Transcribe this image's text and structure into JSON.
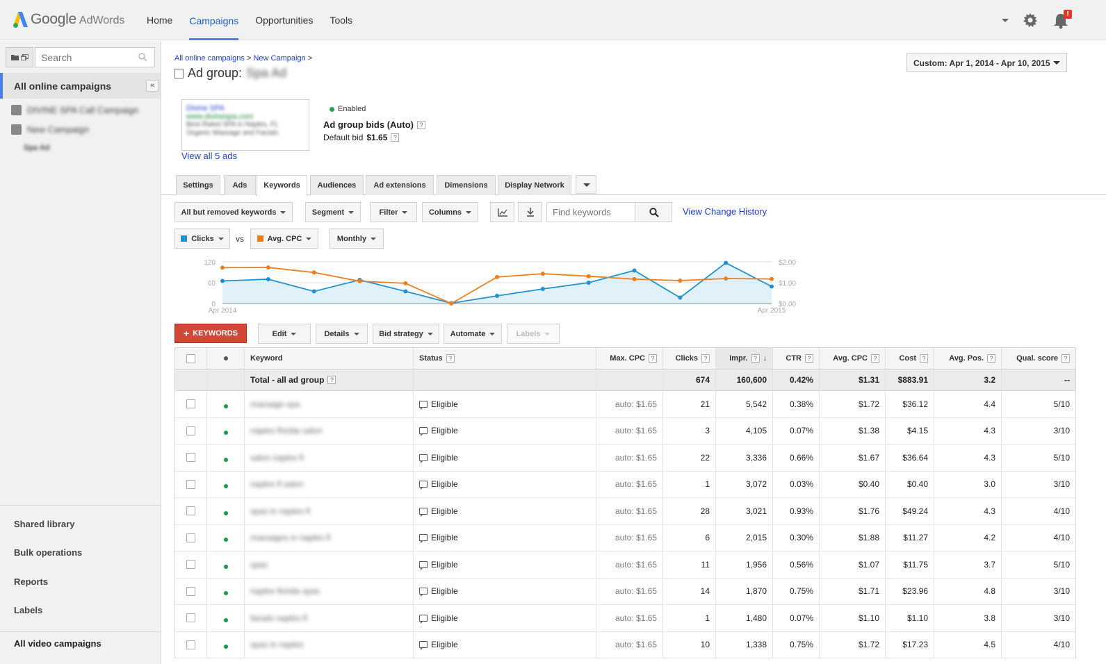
{
  "app": {
    "logo_google": "Google",
    "logo_adwords": "AdWords",
    "nav": [
      "Home",
      "Campaigns",
      "Opportunities",
      "Tools"
    ],
    "nav_active": "Campaigns",
    "notification_badge": "!"
  },
  "sidebar": {
    "search_placeholder": "Search",
    "all_campaigns": "All online campaigns",
    "collapse_glyph": "«",
    "campaigns": [
      {
        "name": "DIVINE SPA Call Campaign",
        "icon": "search-campaign-icon"
      },
      {
        "name": "New Campaign",
        "icon": "display-campaign-icon"
      }
    ],
    "ad_group": "Spa Ad",
    "bottom": [
      "Shared library",
      "Bulk operations",
      "Reports",
      "Labels"
    ],
    "video": "All video campaigns"
  },
  "header": {
    "breadcrumb": [
      "All online campaigns",
      "New Campaign"
    ],
    "separator": ">",
    "title_prefix": "Ad group:",
    "title_name": "Spa Ad",
    "date_range": "Custom: Apr 1, 2014 - Apr 10, 2015"
  },
  "ad_summary": {
    "preview_lines": [
      "Divine SPA",
      "www.divinespa.com",
      "Best Rated SPA in Naples, FL",
      "Organic Massage and Facials"
    ],
    "view_all": "View all 5 ads",
    "status": "Enabled",
    "bids_label": "Ad group bids (Auto)",
    "default_bid_label": "Default bid",
    "default_bid_value": "$1.65"
  },
  "tabs": [
    "Settings",
    "Ads",
    "Keywords",
    "Audiences",
    "Ad extensions",
    "Dimensions",
    "Display Network"
  ],
  "tab_active": "Keywords",
  "toolbar": {
    "filter_view": "All but removed keywords",
    "segment": "Segment",
    "filter": "Filter",
    "columns": "Columns",
    "find_placeholder": "Find keywords",
    "view_change_history": "View Change History"
  },
  "chart_controls": {
    "metric1": "Clicks",
    "vs": "vs",
    "metric2": "Avg. CPC",
    "period": "Monthly"
  },
  "chart_data": {
    "type": "line",
    "x": [
      "Apr 2014",
      "May 2014",
      "Jun 2014",
      "Jul 2014",
      "Aug 2014",
      "Sep 2014",
      "Oct 2014",
      "Nov 2014",
      "Dec 2014",
      "Jan 2015",
      "Feb 2015",
      "Mar 2015",
      "Apr 2015"
    ],
    "x_tick_labels": [
      "Apr 2014",
      "Apr 2015"
    ],
    "series": [
      {
        "name": "Clicks",
        "axis": "left",
        "color": "#1f91d2",
        "values": [
          65,
          70,
          35,
          68,
          35,
          1,
          22,
          42,
          60,
          95,
          17,
          117,
          49
        ]
      },
      {
        "name": "Avg. CPC",
        "axis": "right",
        "color": "#f07d1b",
        "values": [
          1.72,
          1.73,
          1.49,
          1.07,
          0.97,
          0.0,
          1.27,
          1.43,
          1.31,
          1.17,
          1.1,
          1.2,
          1.18
        ]
      }
    ],
    "y_left": {
      "ticks": [
        "120",
        "60",
        "0"
      ],
      "range": [
        0,
        120
      ]
    },
    "y_right": {
      "ticks": [
        "$2.00",
        "$1.00",
        "$0.00"
      ],
      "range": [
        0,
        2
      ]
    },
    "grid": true
  },
  "actions": {
    "add_keywords": "KEYWORDS",
    "edit": "Edit",
    "details": "Details",
    "bid_strategy": "Bid strategy",
    "automate": "Automate",
    "labels": "Labels"
  },
  "table": {
    "headers": {
      "keyword": "Keyword",
      "status": "Status",
      "max_cpc": "Max. CPC",
      "clicks": "Clicks",
      "impr": "Impr.",
      "ctr": "CTR",
      "avg_cpc": "Avg. CPC",
      "cost": "Cost",
      "avg_pos": "Avg. Pos.",
      "qual": "Qual. score"
    },
    "total": {
      "label": "Total - all ad group",
      "clicks": "674",
      "impr": "160,600",
      "ctr": "0.42%",
      "avg_cpc": "$1.31",
      "cost": "$883.91",
      "avg_pos": "3.2",
      "qual": "--"
    },
    "rows": [
      {
        "keyword": "massage spa",
        "status": "Eligible",
        "max_cpc": "auto: $1.65",
        "clicks": "21",
        "impr": "5,542",
        "ctr": "0.38%",
        "avg_cpc": "$1.72",
        "cost": "$36.12",
        "avg_pos": "4.4",
        "qual": "5/10"
      },
      {
        "keyword": "naples florida salon",
        "status": "Eligible",
        "max_cpc": "auto: $1.65",
        "clicks": "3",
        "impr": "4,105",
        "ctr": "0.07%",
        "avg_cpc": "$1.38",
        "cost": "$4.15",
        "avg_pos": "4.3",
        "qual": "3/10"
      },
      {
        "keyword": "salon naples fl",
        "status": "Eligible",
        "max_cpc": "auto: $1.65",
        "clicks": "22",
        "impr": "3,336",
        "ctr": "0.66%",
        "avg_cpc": "$1.67",
        "cost": "$36.64",
        "avg_pos": "4.3",
        "qual": "5/10"
      },
      {
        "keyword": "naples fl salon",
        "status": "Eligible",
        "max_cpc": "auto: $1.65",
        "clicks": "1",
        "impr": "3,072",
        "ctr": "0.03%",
        "avg_cpc": "$0.40",
        "cost": "$0.40",
        "avg_pos": "3.0",
        "qual": "3/10"
      },
      {
        "keyword": "spas in naples fl",
        "status": "Eligible",
        "max_cpc": "auto: $1.65",
        "clicks": "28",
        "impr": "3,021",
        "ctr": "0.93%",
        "avg_cpc": "$1.76",
        "cost": "$49.24",
        "avg_pos": "4.3",
        "qual": "4/10"
      },
      {
        "keyword": "massages in naples fl",
        "status": "Eligible",
        "max_cpc": "auto: $1.65",
        "clicks": "6",
        "impr": "2,015",
        "ctr": "0.30%",
        "avg_cpc": "$1.88",
        "cost": "$11.27",
        "avg_pos": "4.2",
        "qual": "4/10"
      },
      {
        "keyword": "spas",
        "status": "Eligible",
        "max_cpc": "auto: $1.65",
        "clicks": "11",
        "impr": "1,956",
        "ctr": "0.56%",
        "avg_cpc": "$1.07",
        "cost": "$11.75",
        "avg_pos": "3.7",
        "qual": "5/10"
      },
      {
        "keyword": "naples florida spas",
        "status": "Eligible",
        "max_cpc": "auto: $1.65",
        "clicks": "14",
        "impr": "1,870",
        "ctr": "0.75%",
        "avg_cpc": "$1.71",
        "cost": "$23.96",
        "avg_pos": "4.8",
        "qual": "3/10"
      },
      {
        "keyword": "facials naples fl",
        "status": "Eligible",
        "max_cpc": "auto: $1.65",
        "clicks": "1",
        "impr": "1,480",
        "ctr": "0.07%",
        "avg_cpc": "$1.10",
        "cost": "$1.10",
        "avg_pos": "3.8",
        "qual": "3/10"
      },
      {
        "keyword": "spas in naples",
        "status": "Eligible",
        "max_cpc": "auto: $1.65",
        "clicks": "10",
        "impr": "1,338",
        "ctr": "0.75%",
        "avg_cpc": "$1.72",
        "cost": "$17.23",
        "avg_pos": "4.5",
        "qual": "4/10"
      }
    ]
  }
}
